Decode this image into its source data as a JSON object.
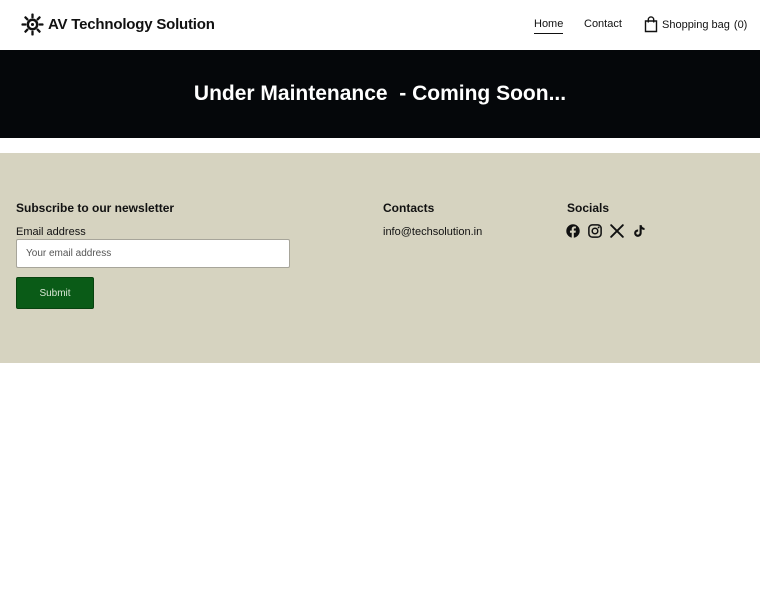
{
  "header": {
    "brand": "AV Technology Solution",
    "brand_icon": "gear-logo-icon",
    "nav": {
      "home": "Home",
      "contact": "Contact"
    },
    "bag": {
      "label": "Shopping bag",
      "count": "(0)",
      "icon": "shopping-bag-icon"
    }
  },
  "banner": {
    "text": "Under Maintenance  - Coming Soon..."
  },
  "footer": {
    "newsletter": {
      "title": "Subscribe to our newsletter",
      "email_label": "Email address",
      "email_placeholder": "Your email address",
      "email_value": "",
      "submit_label": "Submit"
    },
    "contacts": {
      "title": "Contacts",
      "email": "info@techsolution.in"
    },
    "socials": {
      "title": "Socials",
      "icons": [
        "facebook-icon",
        "instagram-icon",
        "x-icon",
        "tiktok-icon"
      ]
    }
  },
  "colors": {
    "banner_bg": "#05070a",
    "footer_bg": "#d6d3c0",
    "submit_bg": "#0a5b17"
  }
}
